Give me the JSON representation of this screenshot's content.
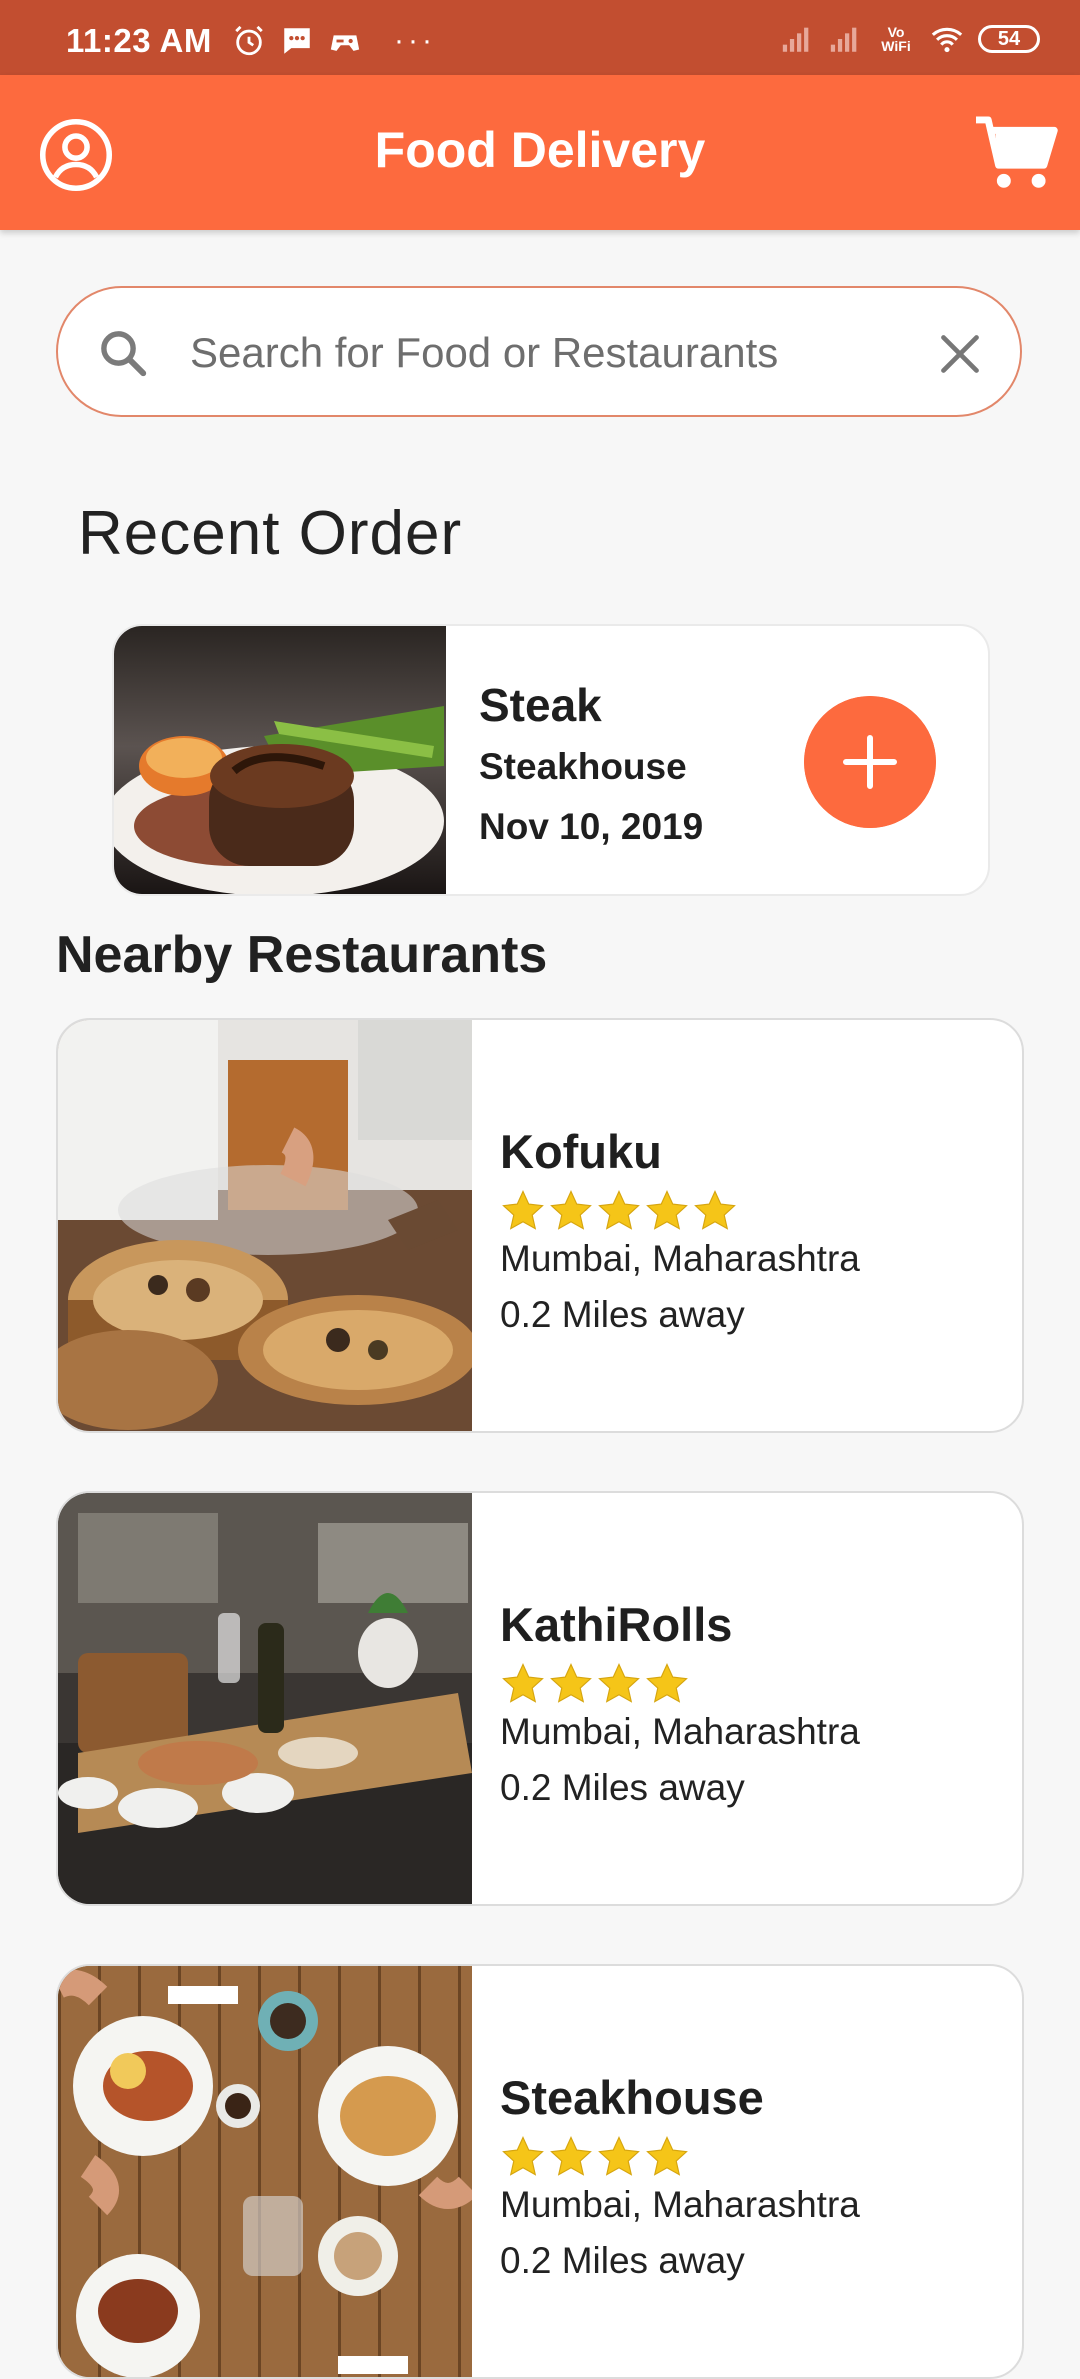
{
  "status_bar": {
    "time": "11:23 AM",
    "vowifi": "Vo WiFi",
    "battery": "54"
  },
  "header": {
    "title": "Food Delivery"
  },
  "search": {
    "placeholder": "Search for Food or Restaurants",
    "value": ""
  },
  "recent": {
    "section_title": "Recent Order",
    "item": {
      "name": "Steak",
      "restaurant": "Steakhouse",
      "date": "Nov 10, 2019"
    }
  },
  "nearby": {
    "section_title": "Nearby Restaurants",
    "restaurants": [
      {
        "name": "Kofuku",
        "rating": 5,
        "location": "Mumbai, Maharashtra",
        "distance": "0.2 Miles away"
      },
      {
        "name": "KathiRolls",
        "rating": 4,
        "location": "Mumbai, Maharashtra",
        "distance": "0.2 Miles away"
      },
      {
        "name": "Steakhouse",
        "rating": 4,
        "location": "Mumbai, Maharashtra",
        "distance": "0.2 Miles away"
      }
    ]
  },
  "colors": {
    "accent": "#fd6a3e",
    "status_bar": "#c24e30",
    "star": "#f5c518"
  }
}
